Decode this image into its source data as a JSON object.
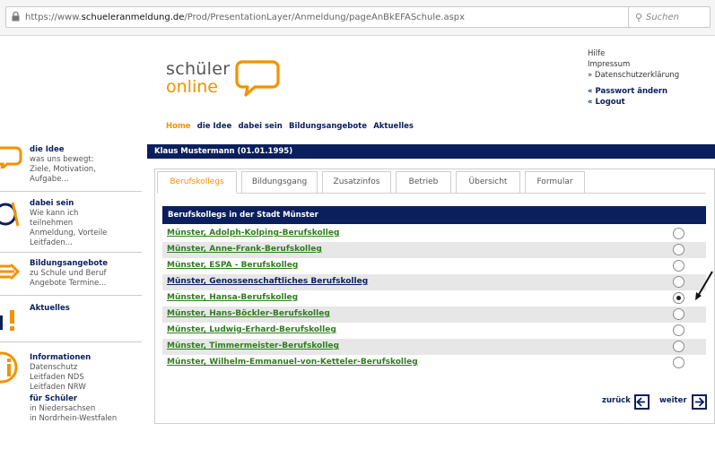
{
  "browser": {
    "url_prefix": "https://www.",
    "url_host": "schueleranmeldung.de",
    "url_path": "/Prod/PresentationLayer/Anmeldung/pageAnBkEFASchule.aspx",
    "search_placeholder": "Suchen"
  },
  "logo": {
    "line1": "schüler",
    "line2": "online"
  },
  "toplinks": {
    "help": "Hilfe",
    "impressum": "Impressum",
    "privacy": "» Datenschutzerklärung",
    "change_password": "« Passwort ändern",
    "logout": "« Logout"
  },
  "mainnav": [
    "Home",
    "die Idee",
    "dabei sein",
    "Bildungsangebote",
    "Aktuelles"
  ],
  "sidebar": [
    {
      "title": "die Idee",
      "text": [
        "was uns bewegt:",
        "Ziele, Motivation,",
        "Aufgabe..."
      ]
    },
    {
      "title": "dabei sein",
      "text": [
        "Wie kann ich",
        "teilnehmen",
        "Anmeldung, Vorteile",
        "Leitfaden..."
      ]
    },
    {
      "title": "Bildungsangebote",
      "text": [
        "zu Schule und Beruf",
        "Angebote Termine..."
      ]
    },
    {
      "title": "Aktuelles",
      "text": []
    },
    {
      "title": "Informationen",
      "text": [
        "Datenschutz",
        "Leitfaden NDS",
        "Leitfaden NRW"
      ]
    },
    {
      "title": "für Schüler",
      "text": [
        "in Niedersachsen",
        "in Nordrhein-Westfalen"
      ]
    }
  ],
  "user_bar": "Klaus Mustermann (01.01.1995)",
  "tabs": [
    "Berufskollegs",
    "Bildungsgang",
    "Zusatzinfos",
    "Betrieb",
    "Übersicht",
    "Formular"
  ],
  "active_tab": 0,
  "list_title": "Berufskollegs in der Stadt Münster",
  "schools": [
    {
      "name": "Münster, Adolph-Kolping-Berufskolleg",
      "selected": false,
      "color": "green"
    },
    {
      "name": "Münster, Anne-Frank-Berufskolleg",
      "selected": false,
      "color": "green"
    },
    {
      "name": "Münster, ESPA - Berufskolleg",
      "selected": false,
      "color": "green"
    },
    {
      "name": "Münster, Genossenschaftliches Berufskolleg",
      "selected": false,
      "color": "blue"
    },
    {
      "name": "Münster, Hansa-Berufskolleg",
      "selected": true,
      "color": "green"
    },
    {
      "name": "Münster, Hans-Böckler-Berufskolleg",
      "selected": false,
      "color": "green"
    },
    {
      "name": "Münster, Ludwig-Erhard-Berufskolleg",
      "selected": false,
      "color": "green"
    },
    {
      "name": "Münster, Timmermeister-Berufskolleg",
      "selected": false,
      "color": "green"
    },
    {
      "name": "Münster, Wilhelm-Emmanuel-von-Ketteler-Berufskolleg",
      "selected": false,
      "color": "green"
    }
  ],
  "pager": {
    "back": "zurück",
    "next": "weiter"
  },
  "colors": {
    "navy": "#0a1f5c",
    "orange": "#f39200",
    "link_green": "#2e7d1e",
    "row_gray": "#e7e7e7"
  }
}
